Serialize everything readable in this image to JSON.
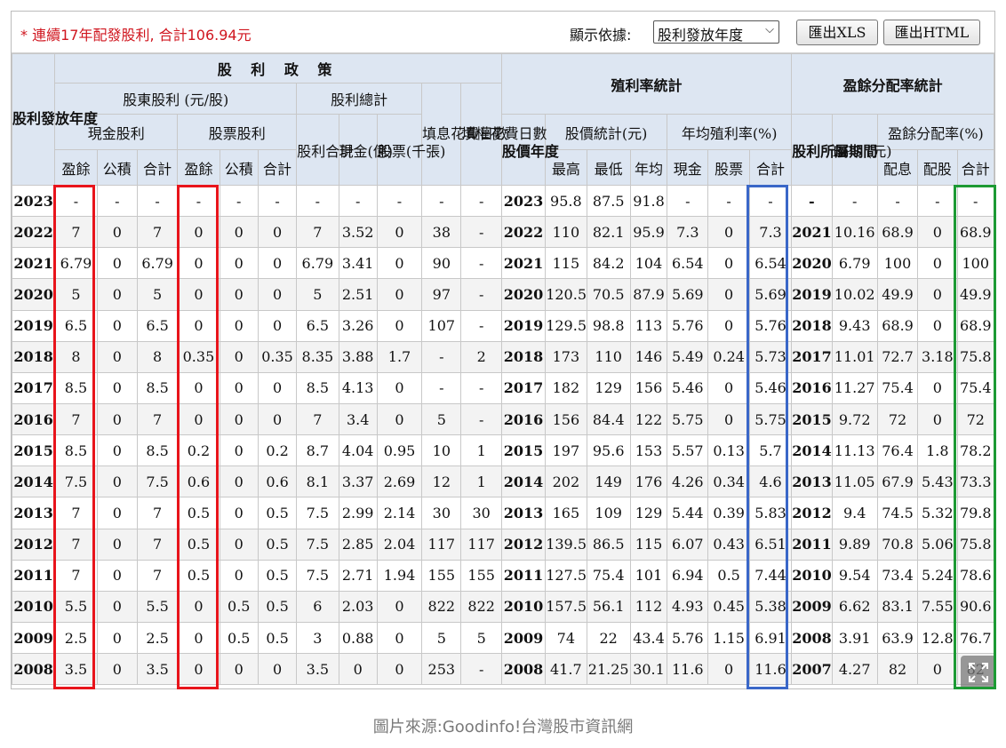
{
  "toolbar": {
    "notice": "* 連續17年配發股利, 合計106.94元",
    "sort_label": "顯示依據:",
    "sort_value": "股利發放年度",
    "export_xls": "匯出XLS",
    "export_html": "匯出HTML"
  },
  "headers": {
    "dividend_policy": "股 利 政 策",
    "yield_stats": "殖利率統計",
    "payout_stats": "盈餘分配率統計",
    "dividend_year": "股利發放年度",
    "shareholder_dividend": "股東股利 (元/股)",
    "dividend_total": "股利總計",
    "fill_div_days": "填息花費日數",
    "fill_right_days": "填權花費日數",
    "price_year": "股價年度",
    "price_stats": "股價統計(元)",
    "avg_yield": "年均殖利率(%)",
    "dividend_period": "股利所屬期間",
    "eps": "EPS (元)",
    "payout_ratio": "盈餘分配率(%)",
    "cash_dividend": "現金股利",
    "stock_dividend": "股票股利",
    "div_sum": "股利合計",
    "cash_100m": "現金(億)",
    "stock_1000": "股票(千張)",
    "earnings": "盈餘",
    "reserve": "公積",
    "total": "合計",
    "earnings2": "盈餘",
    "reserve2": "公積",
    "total2": "合計",
    "high": "最高",
    "low": "最低",
    "avg": "年均",
    "cash": "現金",
    "stock": "股票",
    "yield_total": "合計",
    "pay_cash": "配息",
    "pay_stock": "配股",
    "pay_total": "合計"
  },
  "rows": [
    [
      "2023",
      "-",
      "-",
      "-",
      "-",
      "-",
      "-",
      "-",
      "-",
      "-",
      "-",
      "-",
      "2023",
      "95.8",
      "87.5",
      "91.8",
      "-",
      "-",
      "-",
      "-",
      "-",
      "-",
      "-",
      "-"
    ],
    [
      "2022",
      "7",
      "0",
      "7",
      "0",
      "0",
      "0",
      "7",
      "3.52",
      "0",
      "38",
      "-",
      "2022",
      "110",
      "82.1",
      "95.9",
      "7.3",
      "0",
      "7.3",
      "2021",
      "10.16",
      "68.9",
      "0",
      "68.9"
    ],
    [
      "2021",
      "6.79",
      "0",
      "6.79",
      "0",
      "0",
      "0",
      "6.79",
      "3.41",
      "0",
      "90",
      "-",
      "2021",
      "115",
      "84.2",
      "104",
      "6.54",
      "0",
      "6.54",
      "2020",
      "6.79",
      "100",
      "0",
      "100"
    ],
    [
      "2020",
      "5",
      "0",
      "5",
      "0",
      "0",
      "0",
      "5",
      "2.51",
      "0",
      "97",
      "-",
      "2020",
      "120.5",
      "70.5",
      "87.9",
      "5.69",
      "0",
      "5.69",
      "2019",
      "10.02",
      "49.9",
      "0",
      "49.9"
    ],
    [
      "2019",
      "6.5",
      "0",
      "6.5",
      "0",
      "0",
      "0",
      "6.5",
      "3.26",
      "0",
      "107",
      "-",
      "2019",
      "129.5",
      "98.8",
      "113",
      "5.76",
      "0",
      "5.76",
      "2018",
      "9.43",
      "68.9",
      "0",
      "68.9"
    ],
    [
      "2018",
      "8",
      "0",
      "8",
      "0.35",
      "0",
      "0.35",
      "8.35",
      "3.88",
      "1.7",
      "-",
      "2",
      "2018",
      "173",
      "110",
      "146",
      "5.49",
      "0.24",
      "5.73",
      "2017",
      "11.01",
      "72.7",
      "3.18",
      "75.8"
    ],
    [
      "2017",
      "8.5",
      "0",
      "8.5",
      "0",
      "0",
      "0",
      "8.5",
      "4.13",
      "0",
      "-",
      "-",
      "2017",
      "182",
      "129",
      "156",
      "5.46",
      "0",
      "5.46",
      "2016",
      "11.27",
      "75.4",
      "0",
      "75.4"
    ],
    [
      "2016",
      "7",
      "0",
      "7",
      "0",
      "0",
      "0",
      "7",
      "3.4",
      "0",
      "5",
      "-",
      "2016",
      "156",
      "84.4",
      "122",
      "5.75",
      "0",
      "5.75",
      "2015",
      "9.72",
      "72",
      "0",
      "72"
    ],
    [
      "2015",
      "8.5",
      "0",
      "8.5",
      "0.2",
      "0",
      "0.2",
      "8.7",
      "4.04",
      "0.95",
      "10",
      "1",
      "2015",
      "197",
      "95.6",
      "153",
      "5.57",
      "0.13",
      "5.7",
      "2014",
      "11.13",
      "76.4",
      "1.8",
      "78.2"
    ],
    [
      "2014",
      "7.5",
      "0",
      "7.5",
      "0.6",
      "0",
      "0.6",
      "8.1",
      "3.37",
      "2.69",
      "12",
      "1",
      "2014",
      "202",
      "149",
      "176",
      "4.26",
      "0.34",
      "4.6",
      "2013",
      "11.05",
      "67.9",
      "5.43",
      "73.3"
    ],
    [
      "2013",
      "7",
      "0",
      "7",
      "0.5",
      "0",
      "0.5",
      "7.5",
      "2.99",
      "2.14",
      "30",
      "30",
      "2013",
      "165",
      "109",
      "129",
      "5.44",
      "0.39",
      "5.83",
      "2012",
      "9.4",
      "74.5",
      "5.32",
      "79.8"
    ],
    [
      "2012",
      "7",
      "0",
      "7",
      "0.5",
      "0",
      "0.5",
      "7.5",
      "2.85",
      "2.04",
      "117",
      "117",
      "2012",
      "139.5",
      "86.5",
      "115",
      "6.07",
      "0.43",
      "6.51",
      "2011",
      "9.89",
      "70.8",
      "5.06",
      "75.8"
    ],
    [
      "2011",
      "7",
      "0",
      "7",
      "0.5",
      "0",
      "0.5",
      "7.5",
      "2.71",
      "1.94",
      "155",
      "155",
      "2011",
      "127.5",
      "75.4",
      "101",
      "6.94",
      "0.5",
      "7.44",
      "2010",
      "9.54",
      "73.4",
      "5.24",
      "78.6"
    ],
    [
      "2010",
      "5.5",
      "0",
      "5.5",
      "0",
      "0.5",
      "0.5",
      "6",
      "2.03",
      "0",
      "822",
      "822",
      "2010",
      "157.5",
      "56.1",
      "112",
      "4.93",
      "0.45",
      "5.38",
      "2009",
      "6.62",
      "83.1",
      "7.55",
      "90.6"
    ],
    [
      "2009",
      "2.5",
      "0",
      "2.5",
      "0",
      "0.5",
      "0.5",
      "3",
      "0.88",
      "0",
      "5",
      "5",
      "2009",
      "74",
      "22",
      "43.4",
      "5.76",
      "1.15",
      "6.91",
      "2008",
      "3.91",
      "63.9",
      "12.8",
      "76.7"
    ],
    [
      "2008",
      "3.5",
      "0",
      "3.5",
      "0",
      "0",
      "0",
      "3.5",
      "0",
      "0",
      "253",
      "-",
      "2008",
      "41.7",
      "21.25",
      "30.1",
      "11.6",
      "0",
      "11.6",
      "2007",
      "4.27",
      "82",
      "0",
      "82"
    ]
  ],
  "highlights": {
    "earnings_cash_color": "#e8141b",
    "earnings_stock_color": "#e8141b",
    "yield_total_color": "#3a67c8",
    "payout_total_color": "#1d9a34"
  },
  "icons": {
    "expand": "expand-icon",
    "dropdown": "chevron-down-icon"
  },
  "caption": "圖片來源:Goodinfo!台灣股市資訊網"
}
